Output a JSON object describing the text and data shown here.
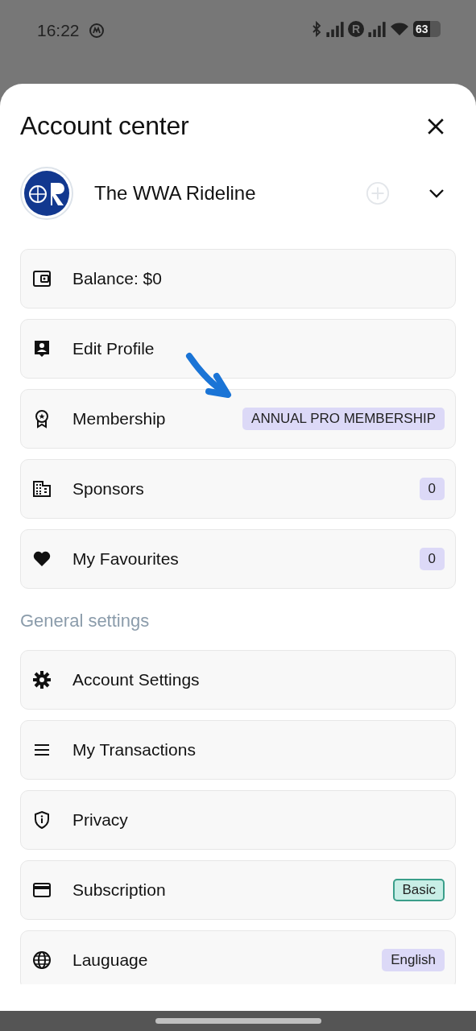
{
  "status_bar": {
    "time": "16:22",
    "carrier_badge": "R",
    "battery": "63"
  },
  "sheet": {
    "title": "Account center",
    "account": {
      "name": "The WWA Rideline"
    }
  },
  "items": [
    {
      "label": "Balance: $0"
    },
    {
      "label": "Edit Profile"
    },
    {
      "label": "Membership",
      "badge": {
        "text": "ANNUAL PRO MEMBERSHIP",
        "kind": "filled",
        "color": "#dcd9f7"
      }
    },
    {
      "label": "Sponsors",
      "badge": {
        "text": "0",
        "kind": "filled",
        "color": "#dcd9f7"
      }
    },
    {
      "label": "My Favourites",
      "badge": {
        "text": "0",
        "kind": "filled",
        "color": "#dcd9f7"
      }
    }
  ],
  "general_settings": {
    "heading": "General settings",
    "items": [
      {
        "label": "Account Settings"
      },
      {
        "label": "My Transactions"
      },
      {
        "label": "Privacy"
      },
      {
        "label": "Subscription",
        "badge": {
          "text": "Basic",
          "kind": "outlined",
          "color": "#c8eee6"
        }
      },
      {
        "label": "Lauguage",
        "badge": {
          "text": "English",
          "kind": "filled",
          "color": "#dcd9f7"
        }
      }
    ]
  }
}
